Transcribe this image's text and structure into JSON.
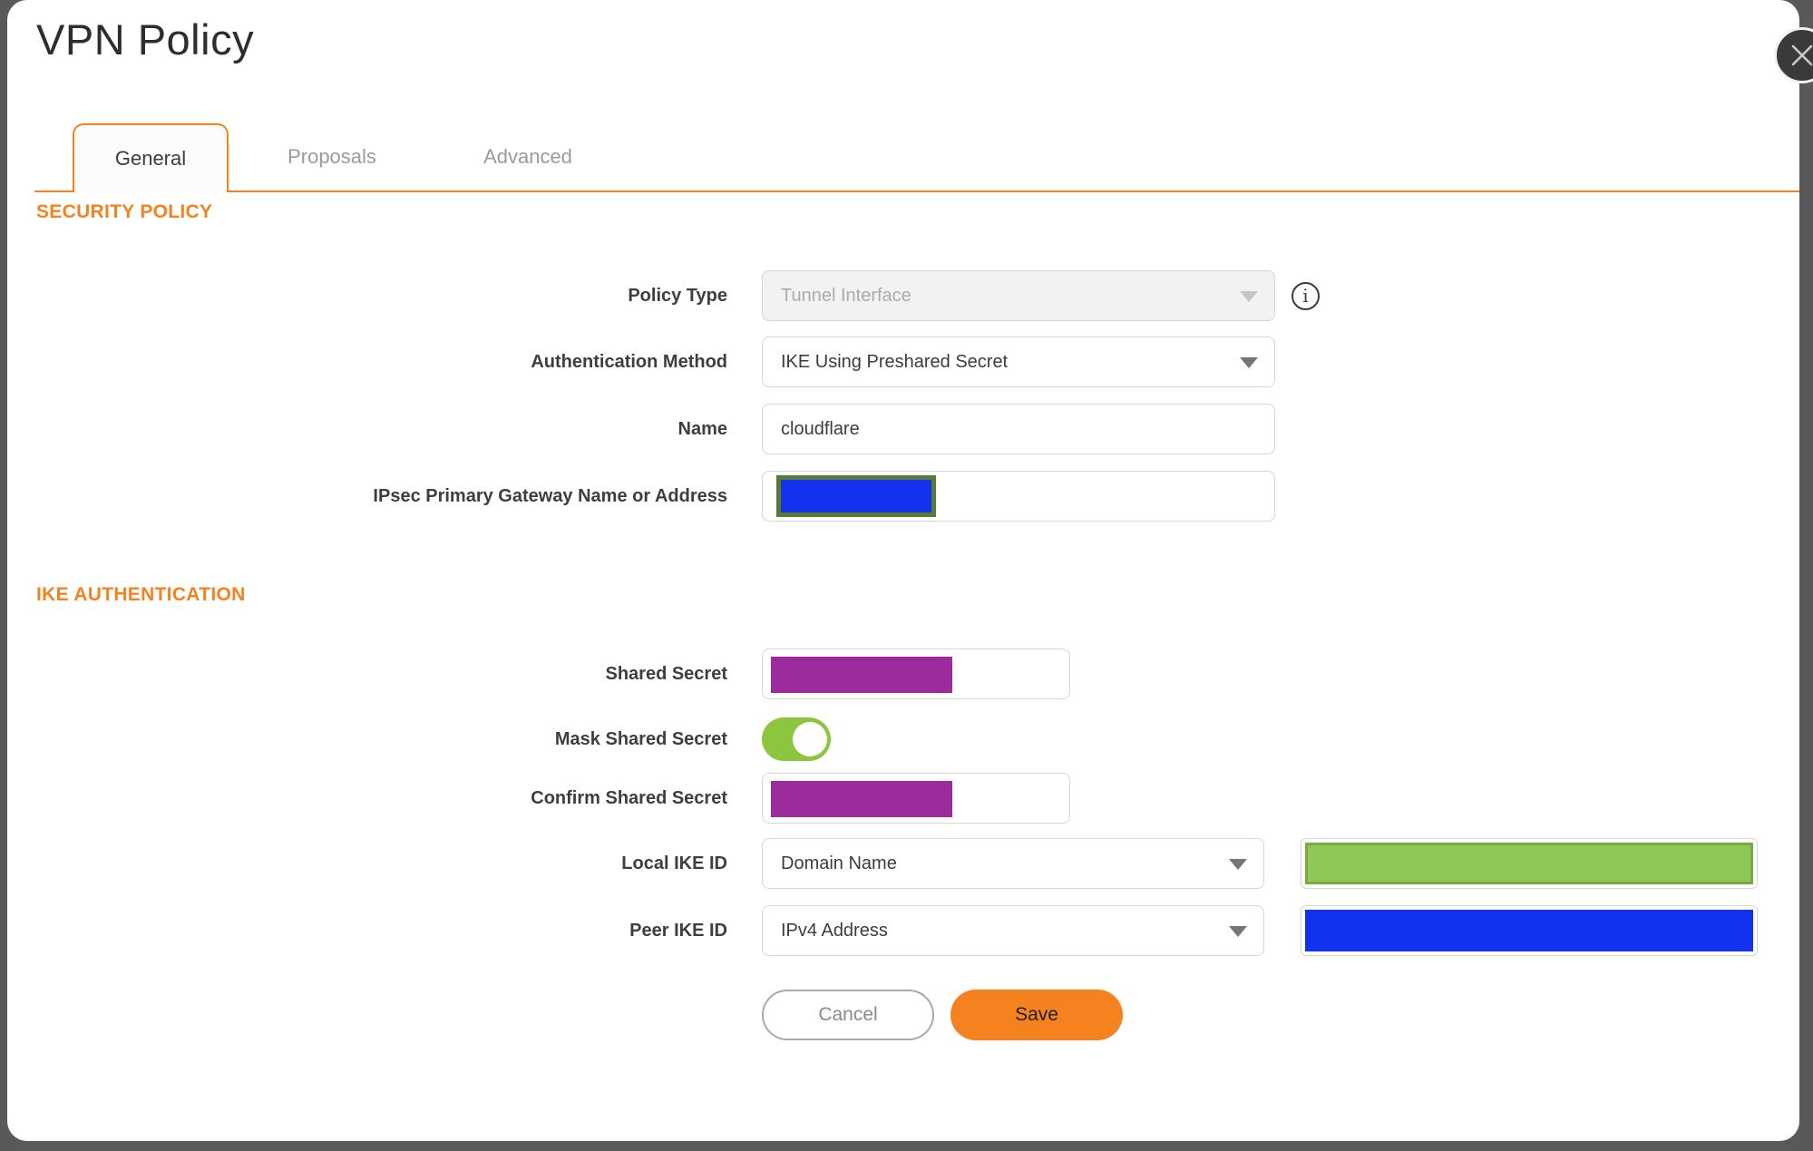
{
  "dialog": {
    "title": "VPN Policy"
  },
  "tabs": [
    {
      "label": "General",
      "active": true
    },
    {
      "label": "Proposals",
      "active": false
    },
    {
      "label": "Advanced",
      "active": false
    }
  ],
  "security_policy": {
    "heading": "SECURITY POLICY",
    "policy_type": {
      "label": "Policy Type",
      "value": "Tunnel Interface",
      "disabled": true
    },
    "auth_method": {
      "label": "Authentication Method",
      "value": "IKE Using Preshared Secret"
    },
    "name": {
      "label": "Name",
      "value": "cloudflare"
    },
    "gateway": {
      "label": "IPsec Primary Gateway Name or Address",
      "value": "",
      "value_redacted": true
    }
  },
  "ike_authentication": {
    "heading": "IKE AUTHENTICATION",
    "shared_secret": {
      "label": "Shared Secret",
      "value": "",
      "value_redacted": true
    },
    "mask_shared_secret": {
      "label": "Mask Shared Secret",
      "enabled": true
    },
    "confirm_shared_secret": {
      "label": "Confirm Shared Secret",
      "value": "",
      "value_redacted": true
    },
    "local_ike_id": {
      "label": "Local IKE ID",
      "type_value": "Domain Name",
      "value": "",
      "value_redacted": true
    },
    "peer_ike_id": {
      "label": "Peer IKE ID",
      "type_value": "IPv4 Address",
      "value": "",
      "value_redacted": true
    }
  },
  "buttons": {
    "cancel": "Cancel",
    "save": "Save"
  },
  "icons": {
    "close": "close-icon",
    "info": "info-icon",
    "info_glyph": "i",
    "dropdown": "chevron-down-icon"
  },
  "colors": {
    "accent_orange": "#F6821F",
    "background_dark": "#58595B",
    "redaction_purple": "#9C2B9D",
    "redaction_blue": "#1232F0",
    "redaction_green_fill": "#8FC858",
    "redaction_green_border": "#76AC3C",
    "redaction_olive_border": "#587B2F",
    "toggle_green": "#8CC63F"
  }
}
